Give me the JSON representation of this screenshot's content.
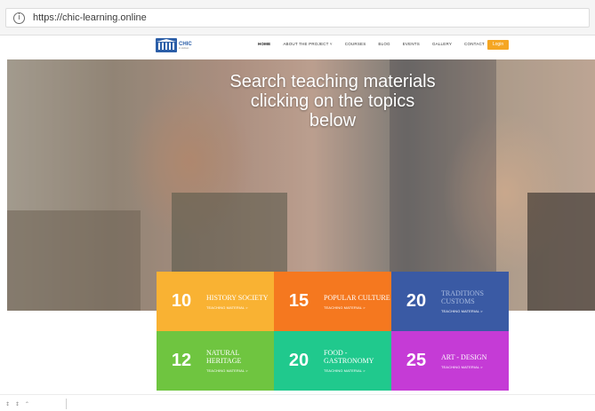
{
  "browser": {
    "url": "https://chic-learning.online",
    "info_icon": "info-icon"
  },
  "site": {
    "logo": {
      "name": "CHIC",
      "tagline": "in Action",
      "icon": "columns-building-logo"
    },
    "nav": [
      {
        "label": "HOME",
        "active": true
      },
      {
        "label": "ABOUT THE PROJECT ˅",
        "active": false
      },
      {
        "label": "COURSES",
        "active": false
      },
      {
        "label": "BLOG",
        "active": false
      },
      {
        "label": "EVENTS",
        "active": false
      },
      {
        "label": "GALLERY",
        "active": false
      },
      {
        "label": "CONTACT",
        "active": false
      }
    ],
    "login_label": "Login",
    "login_color": "#f5a623"
  },
  "hero": {
    "title": "Search teaching materials clicking on the topics below"
  },
  "topics": [
    {
      "count": "10",
      "title": "HISTORY SOCIETY",
      "link": "TEACHING MATERIAL >",
      "color": "#f9b233"
    },
    {
      "count": "15",
      "title": "POPULAR CULTURE",
      "link": "TEACHING MATERIAL >",
      "color": "#f5781f"
    },
    {
      "count": "20",
      "title": "TRADITIONS CUSTOMS",
      "link": "TEACHING MATERIAL >",
      "color": "#3a5aa4"
    },
    {
      "count": "12",
      "title": "NATURAL HERITAGE",
      "link": "TEACHING MATERIAL >",
      "color": "#6fc540"
    },
    {
      "count": "20",
      "title": "FOOD - GASTRONOMY",
      "link": "TEACHING MATERIAL >",
      "color": "#20c98d"
    },
    {
      "count": "25",
      "title": "ART - DESIGN",
      "link": "TEACHING MATERIAL >",
      "color": "#c53bd6"
    }
  ],
  "status_bar": {
    "icons": [
      "thumb-icon",
      "thumb-icon",
      "chevron-up-icon"
    ],
    "text": "↕ ↕ ⌃"
  }
}
